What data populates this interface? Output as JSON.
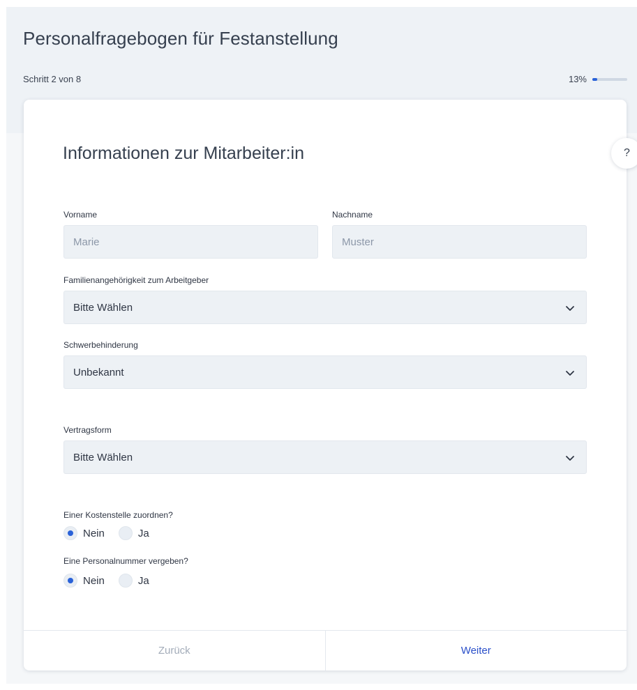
{
  "header": {
    "title": "Personalfragebogen für Festanstellung",
    "step": "Schritt 2 von 8",
    "progress_label": "13%",
    "progress_fraction": 0.13
  },
  "help": {
    "label": "?"
  },
  "card": {
    "title": "Informationen zur Mitarbeiter:in",
    "fields": {
      "firstname": {
        "label": "Vorname",
        "placeholder": "Marie",
        "value": ""
      },
      "lastname": {
        "label": "Nachname",
        "placeholder": "Muster",
        "value": ""
      },
      "family": {
        "label": "Familienangehörigkeit zum Arbeitgeber",
        "selected": "Bitte Wählen"
      },
      "disability": {
        "label": "Schwerbehinderung",
        "selected": "Unbekannt"
      },
      "contract": {
        "label": "Vertragsform",
        "selected": "Bitte Wählen"
      }
    },
    "radios": {
      "cost_center": {
        "question": "Einer Kostenstelle zuordnen?",
        "options": [
          "Nein",
          "Ja"
        ],
        "selected": "Nein"
      },
      "personnel_number": {
        "question": "Eine Personalnummer vergeben?",
        "options": [
          "Nein",
          "Ja"
        ],
        "selected": "Nein"
      }
    }
  },
  "footer": {
    "back_label": "Zurück",
    "next_label": "Weiter"
  },
  "colors": {
    "accent": "#2a62d8",
    "next_text": "#2a4fc9",
    "back_text": "#a3acb9",
    "header_bg": "#eef2f6"
  },
  "icons": {
    "select_chevron": "chevron-down-icon"
  }
}
